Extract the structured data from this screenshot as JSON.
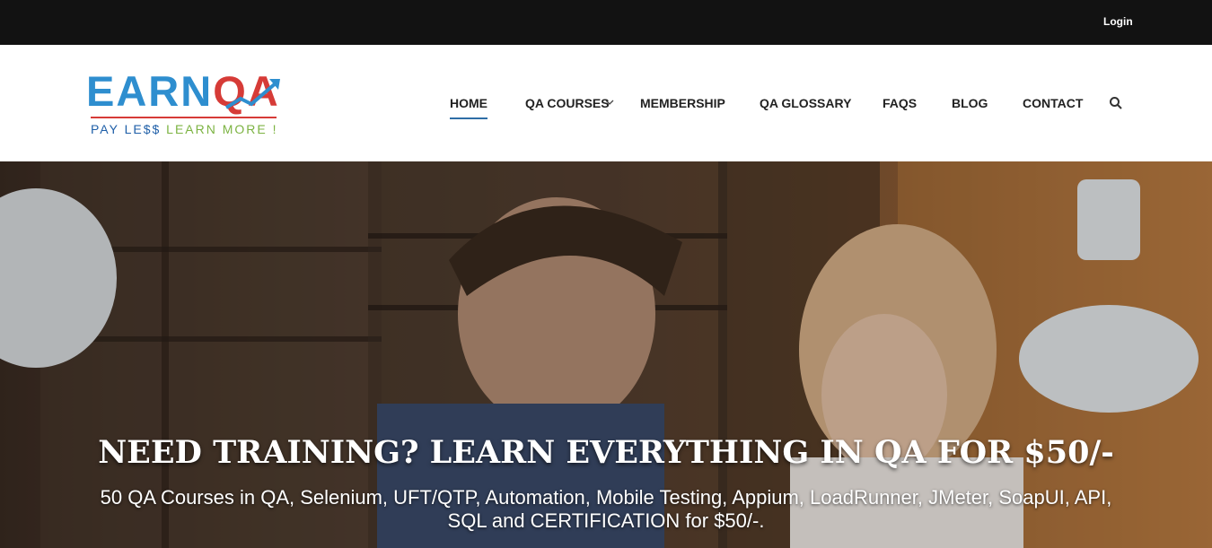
{
  "topbar": {
    "login_label": "Login"
  },
  "logo": {
    "earn": "EARN",
    "qa": "QA",
    "tagline_part1": "PAY LE$$ ",
    "tagline_part2": "LEARN MORE !",
    "colors": {
      "blue": "#2e8ecf",
      "red": "#d63b37",
      "green": "#7cb342"
    }
  },
  "nav": {
    "items": [
      {
        "label": "HOME",
        "active": true
      },
      {
        "label": "QA COURSES",
        "has_dropdown": true
      },
      {
        "label": "MEMBERSHIP"
      },
      {
        "label": "QA GLOSSARY"
      },
      {
        "label": "FAQS"
      },
      {
        "label": "BLOG"
      },
      {
        "label": "CONTACT"
      }
    ],
    "search_icon": "search-icon",
    "dropdown_icon": "chevron-down-icon",
    "active_color": "#2e6ea6"
  },
  "hero": {
    "headline": "NEED TRAINING? LEARN EVERYTHING IN QA FOR $50/-",
    "subtext": "50 QA Courses in QA, Selenium, UFT/QTP, Automation, Mobile Testing, Appium, LoadRunner, JMeter, SoapUI, API, SQL and CERTIFICATION for $50/-."
  }
}
